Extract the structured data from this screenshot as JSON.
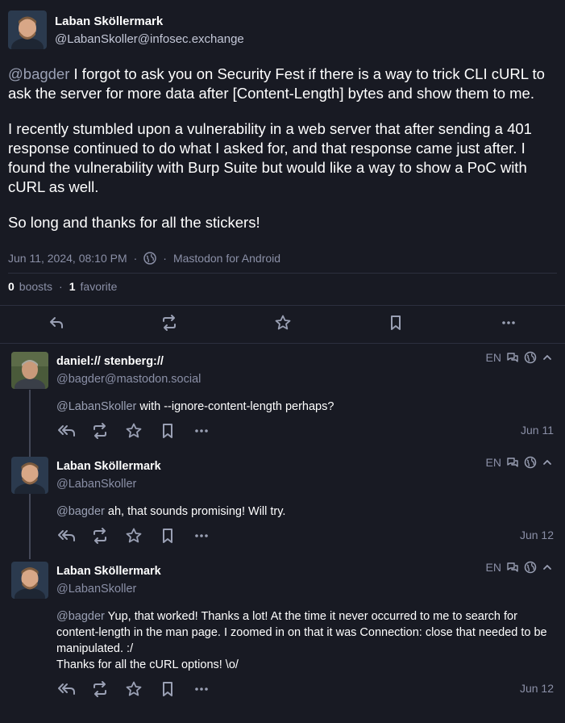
{
  "main_post": {
    "author_name": "Laban Sköllermark",
    "author_handle": "@LabanSkoller@infosec.exchange",
    "mention": "@bagder",
    "paragraph_1_rest": " I forgot to ask you on Security Fest if there is a way to trick CLI cURL to ask the server for more data after [Content-Length] bytes and show them to me.",
    "paragraph_2": "I recently stumbled upon a vulnerability in a web server that after sending a 401 response continued to do what I asked for, and that response came just after. I found the vulnerability with Burp Suite but would like a way to show a PoC with cURL as well.",
    "paragraph_3": "So long and thanks for all the stickers!",
    "timestamp": "Jun 11, 2024, 08:10 PM",
    "client": "Mastodon for Android",
    "boosts_count": "0",
    "boosts_label": "boosts",
    "favorites_count": "1",
    "favorites_label": "favorite",
    "visibility_icon": "globe-icon"
  },
  "replies": [
    {
      "author_name": "daniel:// stenberg://",
      "author_handle": "@bagder@mastodon.social",
      "lang": "EN",
      "mention": "@LabanSkoller",
      "text": " with --ignore-content-length perhaps?",
      "date": "Jun 11"
    },
    {
      "author_name": "Laban Sköllermark",
      "author_handle": "@LabanSkoller",
      "lang": "EN",
      "mention": "@bagder",
      "text": " ah, that sounds promising! Will try.",
      "date": "Jun 12"
    },
    {
      "author_name": "Laban Sköllermark",
      "author_handle": "@LabanSkoller",
      "lang": "EN",
      "mention": "@bagder",
      "text": " Yup, that worked! Thanks a lot! At the time it never occurred to me to search for content-length in the man page. I zoomed in on that it was Connection: close that needed to be manipulated. :/",
      "text_line_2": "Thanks for all the cURL options! \\o/",
      "date": "Jun 12"
    }
  ],
  "colors": {
    "background": "#181a23",
    "muted_text": "#9aa0b4",
    "divider": "#2c2f3e"
  }
}
